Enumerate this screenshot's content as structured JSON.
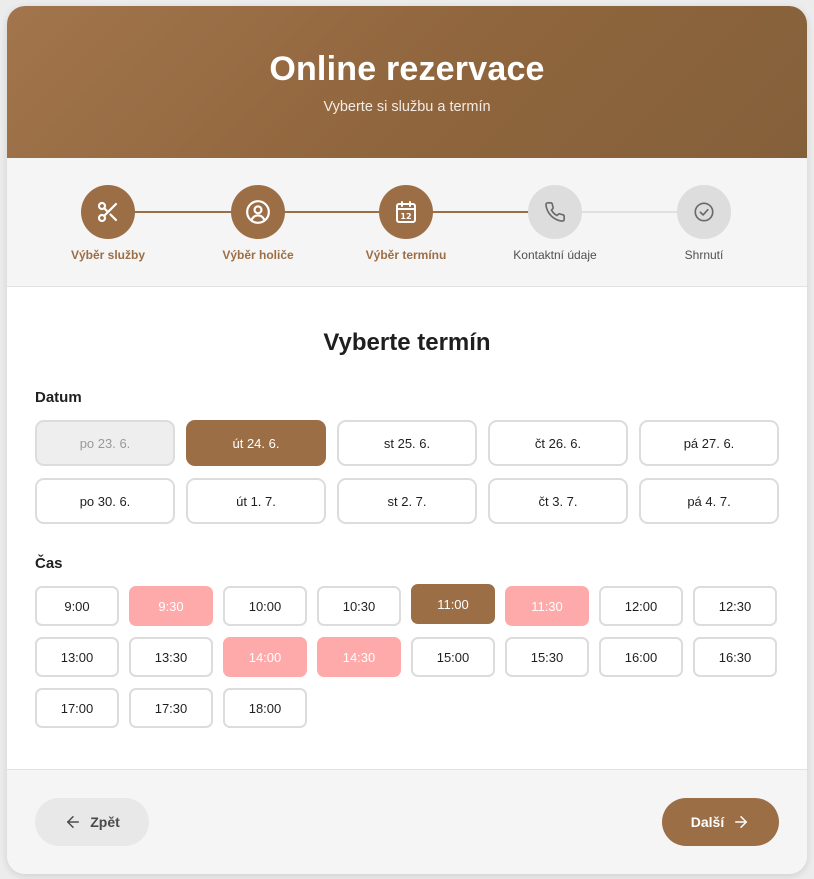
{
  "header": {
    "title": "Online rezervace",
    "subtitle": "Vyberte si službu a termín"
  },
  "colors": {
    "accent": "#9c6e46",
    "booked": "#ffaaaa",
    "inactive_step": "#dddddd",
    "line_inactive": "#e0e0e0"
  },
  "steps": [
    {
      "label": "Výběr služby",
      "icon": "scissors-icon",
      "state": "done"
    },
    {
      "label": "Výběr holiče",
      "icon": "barber-icon",
      "state": "done"
    },
    {
      "label": "Výběr termínu",
      "icon": "calendar-icon",
      "state": "current",
      "calendar_day": "12"
    },
    {
      "label": "Kontaktní údaje",
      "icon": "phone-icon",
      "state": "upcoming"
    },
    {
      "label": "Shrnutí",
      "icon": "check-circle-icon",
      "state": "upcoming"
    }
  ],
  "section": {
    "title": "Vyberte termín",
    "date_label": "Datum",
    "time_label": "Čas"
  },
  "dates": [
    {
      "label": "po 23. 6.",
      "state": "disabled"
    },
    {
      "label": "út 24. 6.",
      "state": "selected"
    },
    {
      "label": "st 25. 6.",
      "state": "available"
    },
    {
      "label": "čt 26. 6.",
      "state": "available"
    },
    {
      "label": "pá 27. 6.",
      "state": "available"
    },
    {
      "label": "po 30. 6.",
      "state": "available"
    },
    {
      "label": "út 1. 7.",
      "state": "available"
    },
    {
      "label": "st 2. 7.",
      "state": "available"
    },
    {
      "label": "čt 3. 7.",
      "state": "available"
    },
    {
      "label": "pá 4. 7.",
      "state": "available"
    }
  ],
  "times": [
    {
      "label": "9:00",
      "state": "available"
    },
    {
      "label": "9:30",
      "state": "booked"
    },
    {
      "label": "10:00",
      "state": "available"
    },
    {
      "label": "10:30",
      "state": "available"
    },
    {
      "label": "11:00",
      "state": "selected"
    },
    {
      "label": "11:30",
      "state": "booked"
    },
    {
      "label": "12:00",
      "state": "available"
    },
    {
      "label": "12:30",
      "state": "available"
    },
    {
      "label": "13:00",
      "state": "available"
    },
    {
      "label": "13:30",
      "state": "available"
    },
    {
      "label": "14:00",
      "state": "booked"
    },
    {
      "label": "14:30",
      "state": "booked"
    },
    {
      "label": "15:00",
      "state": "available"
    },
    {
      "label": "15:30",
      "state": "available"
    },
    {
      "label": "16:00",
      "state": "available"
    },
    {
      "label": "16:30",
      "state": "available"
    },
    {
      "label": "17:00",
      "state": "available"
    },
    {
      "label": "17:30",
      "state": "available"
    },
    {
      "label": "18:00",
      "state": "available"
    }
  ],
  "footer": {
    "back_label": "Zpět",
    "back_icon": "arrow-left-icon",
    "next_label": "Další",
    "next_icon": "arrow-right-icon"
  }
}
